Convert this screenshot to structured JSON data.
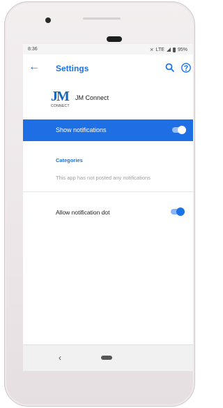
{
  "status_bar": {
    "time": "8:36",
    "network": "LTE",
    "battery": "95%"
  },
  "toolbar": {
    "title": "Settings",
    "icons": [
      "back-arrow-icon",
      "search-icon",
      "help-icon"
    ]
  },
  "app": {
    "logo_text": "JM",
    "logo_subtext": "CONNECT",
    "name": "JM Connect"
  },
  "show_notifications": {
    "label": "Show notifications",
    "enabled": true
  },
  "categories": {
    "heading": "Categories",
    "empty_message": "This app has not posted any notifications"
  },
  "notification_dot": {
    "label": "Allow notification dot",
    "enabled": true
  },
  "colors": {
    "accent": "#1a73e8",
    "highlight_row": "#1e6fe4",
    "muted_text": "#9e9e9e"
  }
}
